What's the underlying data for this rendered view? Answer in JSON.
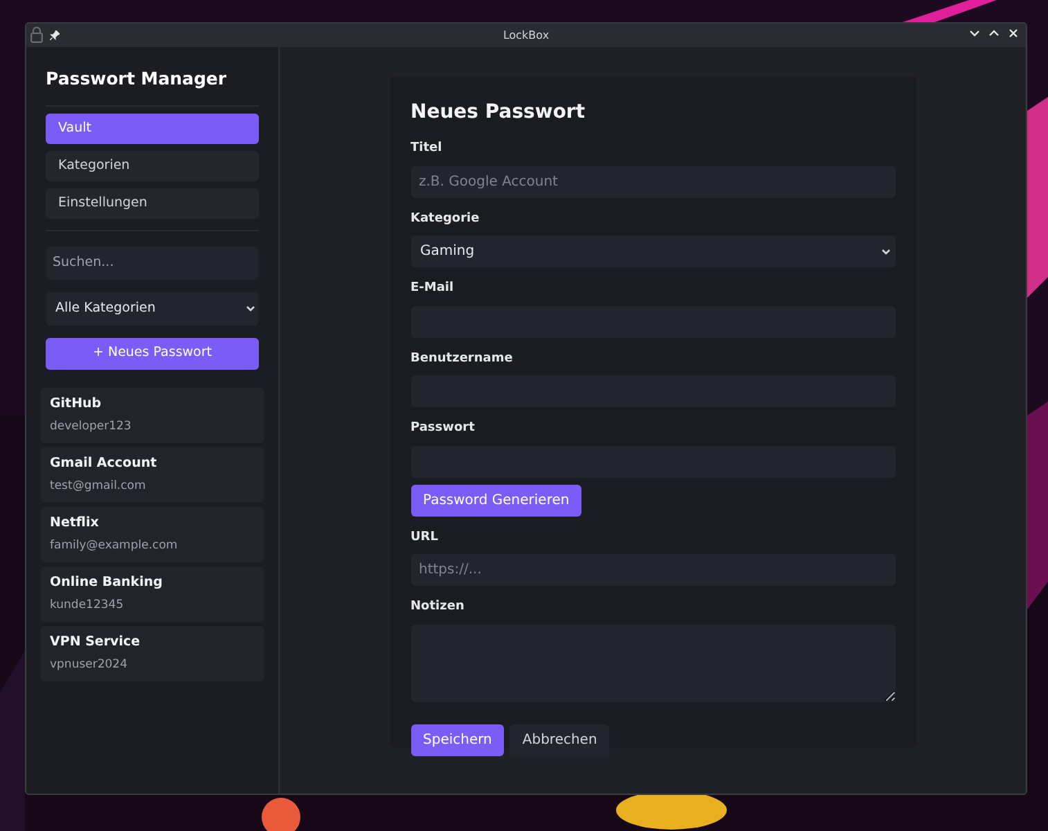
{
  "window": {
    "title": "LockBox"
  },
  "sidebar": {
    "title": "Passwort Manager",
    "nav": [
      {
        "label": "Vault",
        "selected": true
      },
      {
        "label": "Kategorien",
        "selected": false
      },
      {
        "label": "Einstellungen",
        "selected": false
      }
    ],
    "search": {
      "placeholder": "Suchen..."
    },
    "category_filter": {
      "value": "Alle Kategorien"
    },
    "new_button": "+ Neues Passwort",
    "entries": [
      {
        "title": "GitHub",
        "subtitle": "developer123"
      },
      {
        "title": "Gmail Account",
        "subtitle": "test@gmail.com"
      },
      {
        "title": "Netflix",
        "subtitle": "family@example.com"
      },
      {
        "title": "Online Banking",
        "subtitle": "kunde12345"
      },
      {
        "title": "VPN Service",
        "subtitle": "vpnuser2024"
      }
    ]
  },
  "form": {
    "title": "Neues Passwort",
    "fields": [
      {
        "kind": "input",
        "label": "Titel",
        "placeholder": "z.B. Google Account"
      },
      {
        "kind": "select",
        "label": "Kategorie",
        "value": "Gaming"
      },
      {
        "kind": "input",
        "label": "E-Mail"
      },
      {
        "kind": "input",
        "label": "Benutzername"
      },
      {
        "kind": "input",
        "label": "Passwort"
      },
      {
        "kind": "button",
        "label": "Password Generieren"
      },
      {
        "kind": "input",
        "label": "URL",
        "placeholder": "https://..."
      },
      {
        "kind": "textarea",
        "label": "Notizen"
      }
    ],
    "buttons": [
      {
        "label": "Speichern",
        "primary": true
      },
      {
        "label": "Abbrechen",
        "primary": false
      }
    ]
  }
}
